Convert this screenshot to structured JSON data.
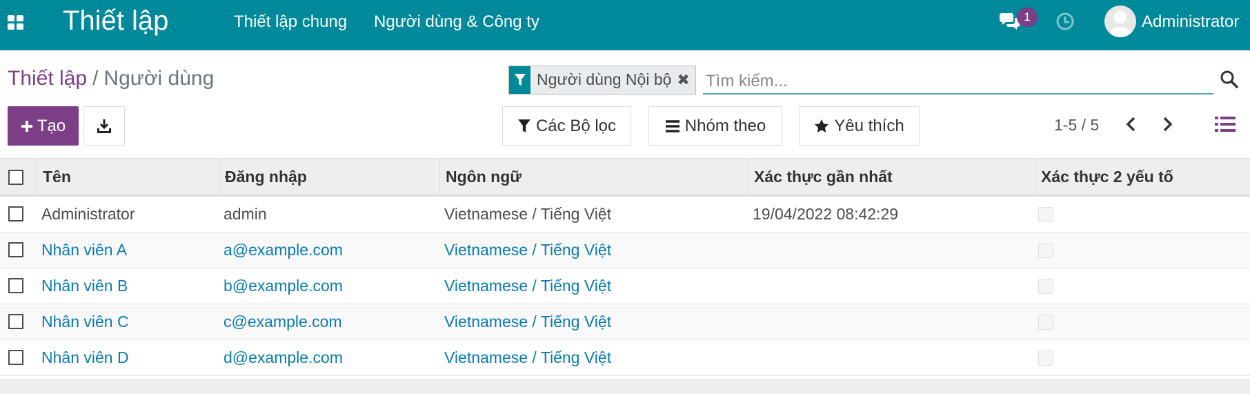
{
  "navbar": {
    "app_title": "Thiết lập",
    "menu": [
      "Thiết lập chung",
      "Người dùng & Công ty"
    ],
    "messages_badge": "1",
    "user_name": "Administrator"
  },
  "breadcrumb": {
    "parent": "Thiết lập",
    "separator": "/",
    "current": "Người dùng"
  },
  "search": {
    "facet_label": "Người dùng Nội bộ",
    "placeholder": "Tìm kiếm..."
  },
  "toolbar": {
    "create_label": "Tạo",
    "filters_label": "Các Bộ lọc",
    "groupby_label": "Nhóm theo",
    "favorites_label": "Yêu thích",
    "pager": "1-5 / 5"
  },
  "table": {
    "columns": [
      "Tên",
      "Đăng nhập",
      "Ngôn ngữ",
      "Xác thực gần nhất",
      "Xác thực 2 yếu tố"
    ],
    "rows": [
      {
        "name": "Administrator",
        "login": "admin",
        "language": "Vietnamese / Tiếng Việt",
        "last_auth": "19/04/2022 08:42:29"
      },
      {
        "name": "Nhân viên A",
        "login": "a@example.com",
        "language": "Vietnamese / Tiếng Việt",
        "last_auth": ""
      },
      {
        "name": "Nhân viên B",
        "login": "b@example.com",
        "language": "Vietnamese / Tiếng Việt",
        "last_auth": ""
      },
      {
        "name": "Nhân viên C",
        "login": "c@example.com",
        "language": "Vietnamese / Tiếng Việt",
        "last_auth": ""
      },
      {
        "name": "Nhân viên D",
        "login": "d@example.com",
        "language": "Vietnamese / Tiếng Việt",
        "last_auth": ""
      }
    ]
  },
  "colors": {
    "navbar": "#00899a",
    "primary": "#7c3f87",
    "link": "#0b7bb0"
  },
  "icons": [
    "apps-icon",
    "chat-icon",
    "clock-icon",
    "filter-icon",
    "close-icon",
    "search-icon",
    "plus-icon",
    "download-icon",
    "star-icon",
    "bars-icon",
    "chevron-left-icon",
    "chevron-right-icon",
    "list-view-icon"
  ]
}
